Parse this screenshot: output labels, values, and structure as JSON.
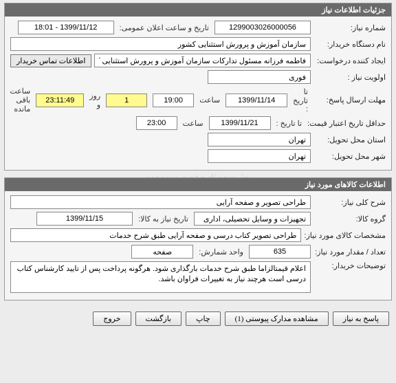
{
  "watermark": {
    "line1": "سامانه تدارکات الکترونیکی دولت",
    "line2": "مرکز توسعه تجارت الکترونیکی",
    "line3": "www.setadiran.ir",
    "line4": "۰۲۱-۸۸۲۴"
  },
  "panel1": {
    "title": "جزئیات اطلاعات نیاز",
    "need_no_label": "شماره نیاز:",
    "need_no": "1299003026000056",
    "announce_label": "تاریخ و ساعت اعلان عمومی:",
    "announce_value": "1399/11/12 - 18:01",
    "buyer_label": "نام دستگاه خریدار:",
    "buyer_value": "سازمان آموزش و پرورش استثنایی کشور",
    "creator_label": "ایجاد کننده درخواست:",
    "creator_value": "فاطمه فرزانه مسئول تدارکات سازمان آموزش و پرورش استثنایی کشور",
    "contact_btn": "اطلاعات تماس خریدار",
    "priority_label": "اولویت نیاز :",
    "priority_value": "فوری",
    "deadline_label": "مهلت ارسال پاسخ:",
    "until_label": "تا تاریخ :",
    "deadline_date": "1399/11/14",
    "time_label": "ساعت",
    "deadline_time": "19:00",
    "days_value": "1",
    "days_label": "روز و",
    "remain_time": "23:11:49",
    "remain_label": "ساعت باقی مانده",
    "validity_label": "حداقل تاریخ اعتبار قیمت:",
    "validity_date": "1399/11/21",
    "validity_time": "23:00",
    "delivery_prov_label": "استان محل تحویل:",
    "delivery_prov": "تهران",
    "delivery_city_label": "شهر محل تحویل:",
    "delivery_city": "تهران"
  },
  "panel2": {
    "title": "اطلاعات کالاهای مورد نیاز",
    "need_desc_label": "شرح کلی نیاز:",
    "need_desc": "طراحی تصویر و صفحه آرایی",
    "group_label": "گروه کالا:",
    "group_value": "تجهیزات و وسایل تحصیلی، اداری",
    "need_by_label": "تاریخ نیاز به کالا:",
    "need_by": "1399/11/15",
    "spec_label": "مشخصات کالای مورد نیاز:",
    "spec_value": "طراحی تصویر کتاب درسی و صفحه آرایی طبق شرح خدمات",
    "qty_label": "تعداد / مقدار مورد نیاز:",
    "qty_value": "635",
    "unit_label": "واحد شمارش:",
    "unit_value": "صفحه",
    "notes_label": "توضیحات خریدار:",
    "notes_value": "اعلام قیمتالزاما طبق شرح خدمات بارگذاری شود. هرگونه پرداخت پس از تایید کارشناس کتاب درسی است هرچند نیاز به تغییرات فراوان باشد."
  },
  "buttons": {
    "respond": "پاسخ به نیاز",
    "attachments": "مشاهده مدارک پیوستی  (1)",
    "print": "چاپ",
    "back": "بازگشت",
    "exit": "خروج"
  }
}
